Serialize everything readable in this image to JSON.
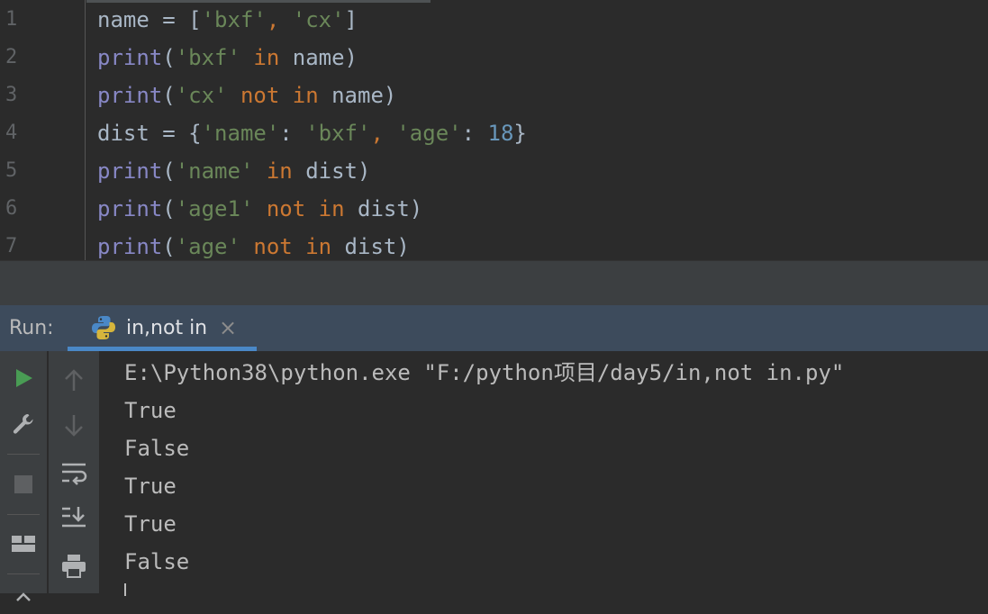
{
  "editor": {
    "lines": [
      {
        "number": "1",
        "tokens": [
          {
            "t": "name = [",
            "c": "plain"
          },
          {
            "t": "'bxf'",
            "c": "string"
          },
          {
            "t": ", ",
            "c": "comma"
          },
          {
            "t": "'cx'",
            "c": "string"
          },
          {
            "t": "]",
            "c": "plain"
          }
        ]
      },
      {
        "number": "2",
        "tokens": [
          {
            "t": "print",
            "c": "builtin"
          },
          {
            "t": "(",
            "c": "plain"
          },
          {
            "t": "'bxf'",
            "c": "string"
          },
          {
            "t": " in ",
            "c": "keyword"
          },
          {
            "t": "name)",
            "c": "plain"
          }
        ]
      },
      {
        "number": "3",
        "tokens": [
          {
            "t": "print",
            "c": "builtin"
          },
          {
            "t": "(",
            "c": "plain"
          },
          {
            "t": "'cx'",
            "c": "string"
          },
          {
            "t": " not in ",
            "c": "keyword"
          },
          {
            "t": "name)",
            "c": "plain"
          }
        ]
      },
      {
        "number": "4",
        "tokens": [
          {
            "t": "dist = {",
            "c": "plain"
          },
          {
            "t": "'name'",
            "c": "string"
          },
          {
            "t": ": ",
            "c": "plain"
          },
          {
            "t": "'bxf'",
            "c": "string"
          },
          {
            "t": ", ",
            "c": "comma"
          },
          {
            "t": "'age'",
            "c": "string"
          },
          {
            "t": ": ",
            "c": "plain"
          },
          {
            "t": "18",
            "c": "number"
          },
          {
            "t": "}",
            "c": "plain"
          }
        ]
      },
      {
        "number": "5",
        "tokens": [
          {
            "t": "print",
            "c": "builtin"
          },
          {
            "t": "(",
            "c": "plain"
          },
          {
            "t": "'name'",
            "c": "string"
          },
          {
            "t": " in ",
            "c": "keyword"
          },
          {
            "t": "dist)",
            "c": "plain"
          }
        ]
      },
      {
        "number": "6",
        "tokens": [
          {
            "t": "print",
            "c": "builtin"
          },
          {
            "t": "(",
            "c": "plain"
          },
          {
            "t": "'age1'",
            "c": "string"
          },
          {
            "t": " not in ",
            "c": "keyword"
          },
          {
            "t": "dist)",
            "c": "plain"
          }
        ]
      },
      {
        "number": "7",
        "tokens": [
          {
            "t": "print",
            "c": "builtin"
          },
          {
            "t": "(",
            "c": "plain"
          },
          {
            "t": "'age'",
            "c": "string"
          },
          {
            "t": " not in ",
            "c": "keyword"
          },
          {
            "t": "dist)",
            "c": "plain"
          }
        ]
      }
    ]
  },
  "run": {
    "label": "Run:",
    "tab": {
      "label": "in,not in",
      "close": "×",
      "icon": "python-icon"
    },
    "console": [
      "E:\\Python38\\python.exe \"F:/python项目/day5/in,not in.py\"",
      "True",
      "False",
      "True",
      "True",
      "False"
    ]
  },
  "toolbar": {
    "left": [
      "run-icon",
      "wrench-icon",
      "stop-icon",
      "layout-icon",
      "up-arrow-icon"
    ],
    "right": [
      "up-arrow-icon",
      "down-arrow-icon",
      "soft-wrap-icon",
      "scroll-to-end-icon",
      "print-icon"
    ]
  },
  "colors": {
    "background": "#2b2b2b",
    "plain": "#a9b7c6",
    "builtin": "#8888c6",
    "string": "#6a8759",
    "keyword": "#cc7832",
    "number": "#6897bb",
    "run_header": "#3d4b5c",
    "tab_underline": "#4a88c7",
    "run_green": "#499c54"
  }
}
